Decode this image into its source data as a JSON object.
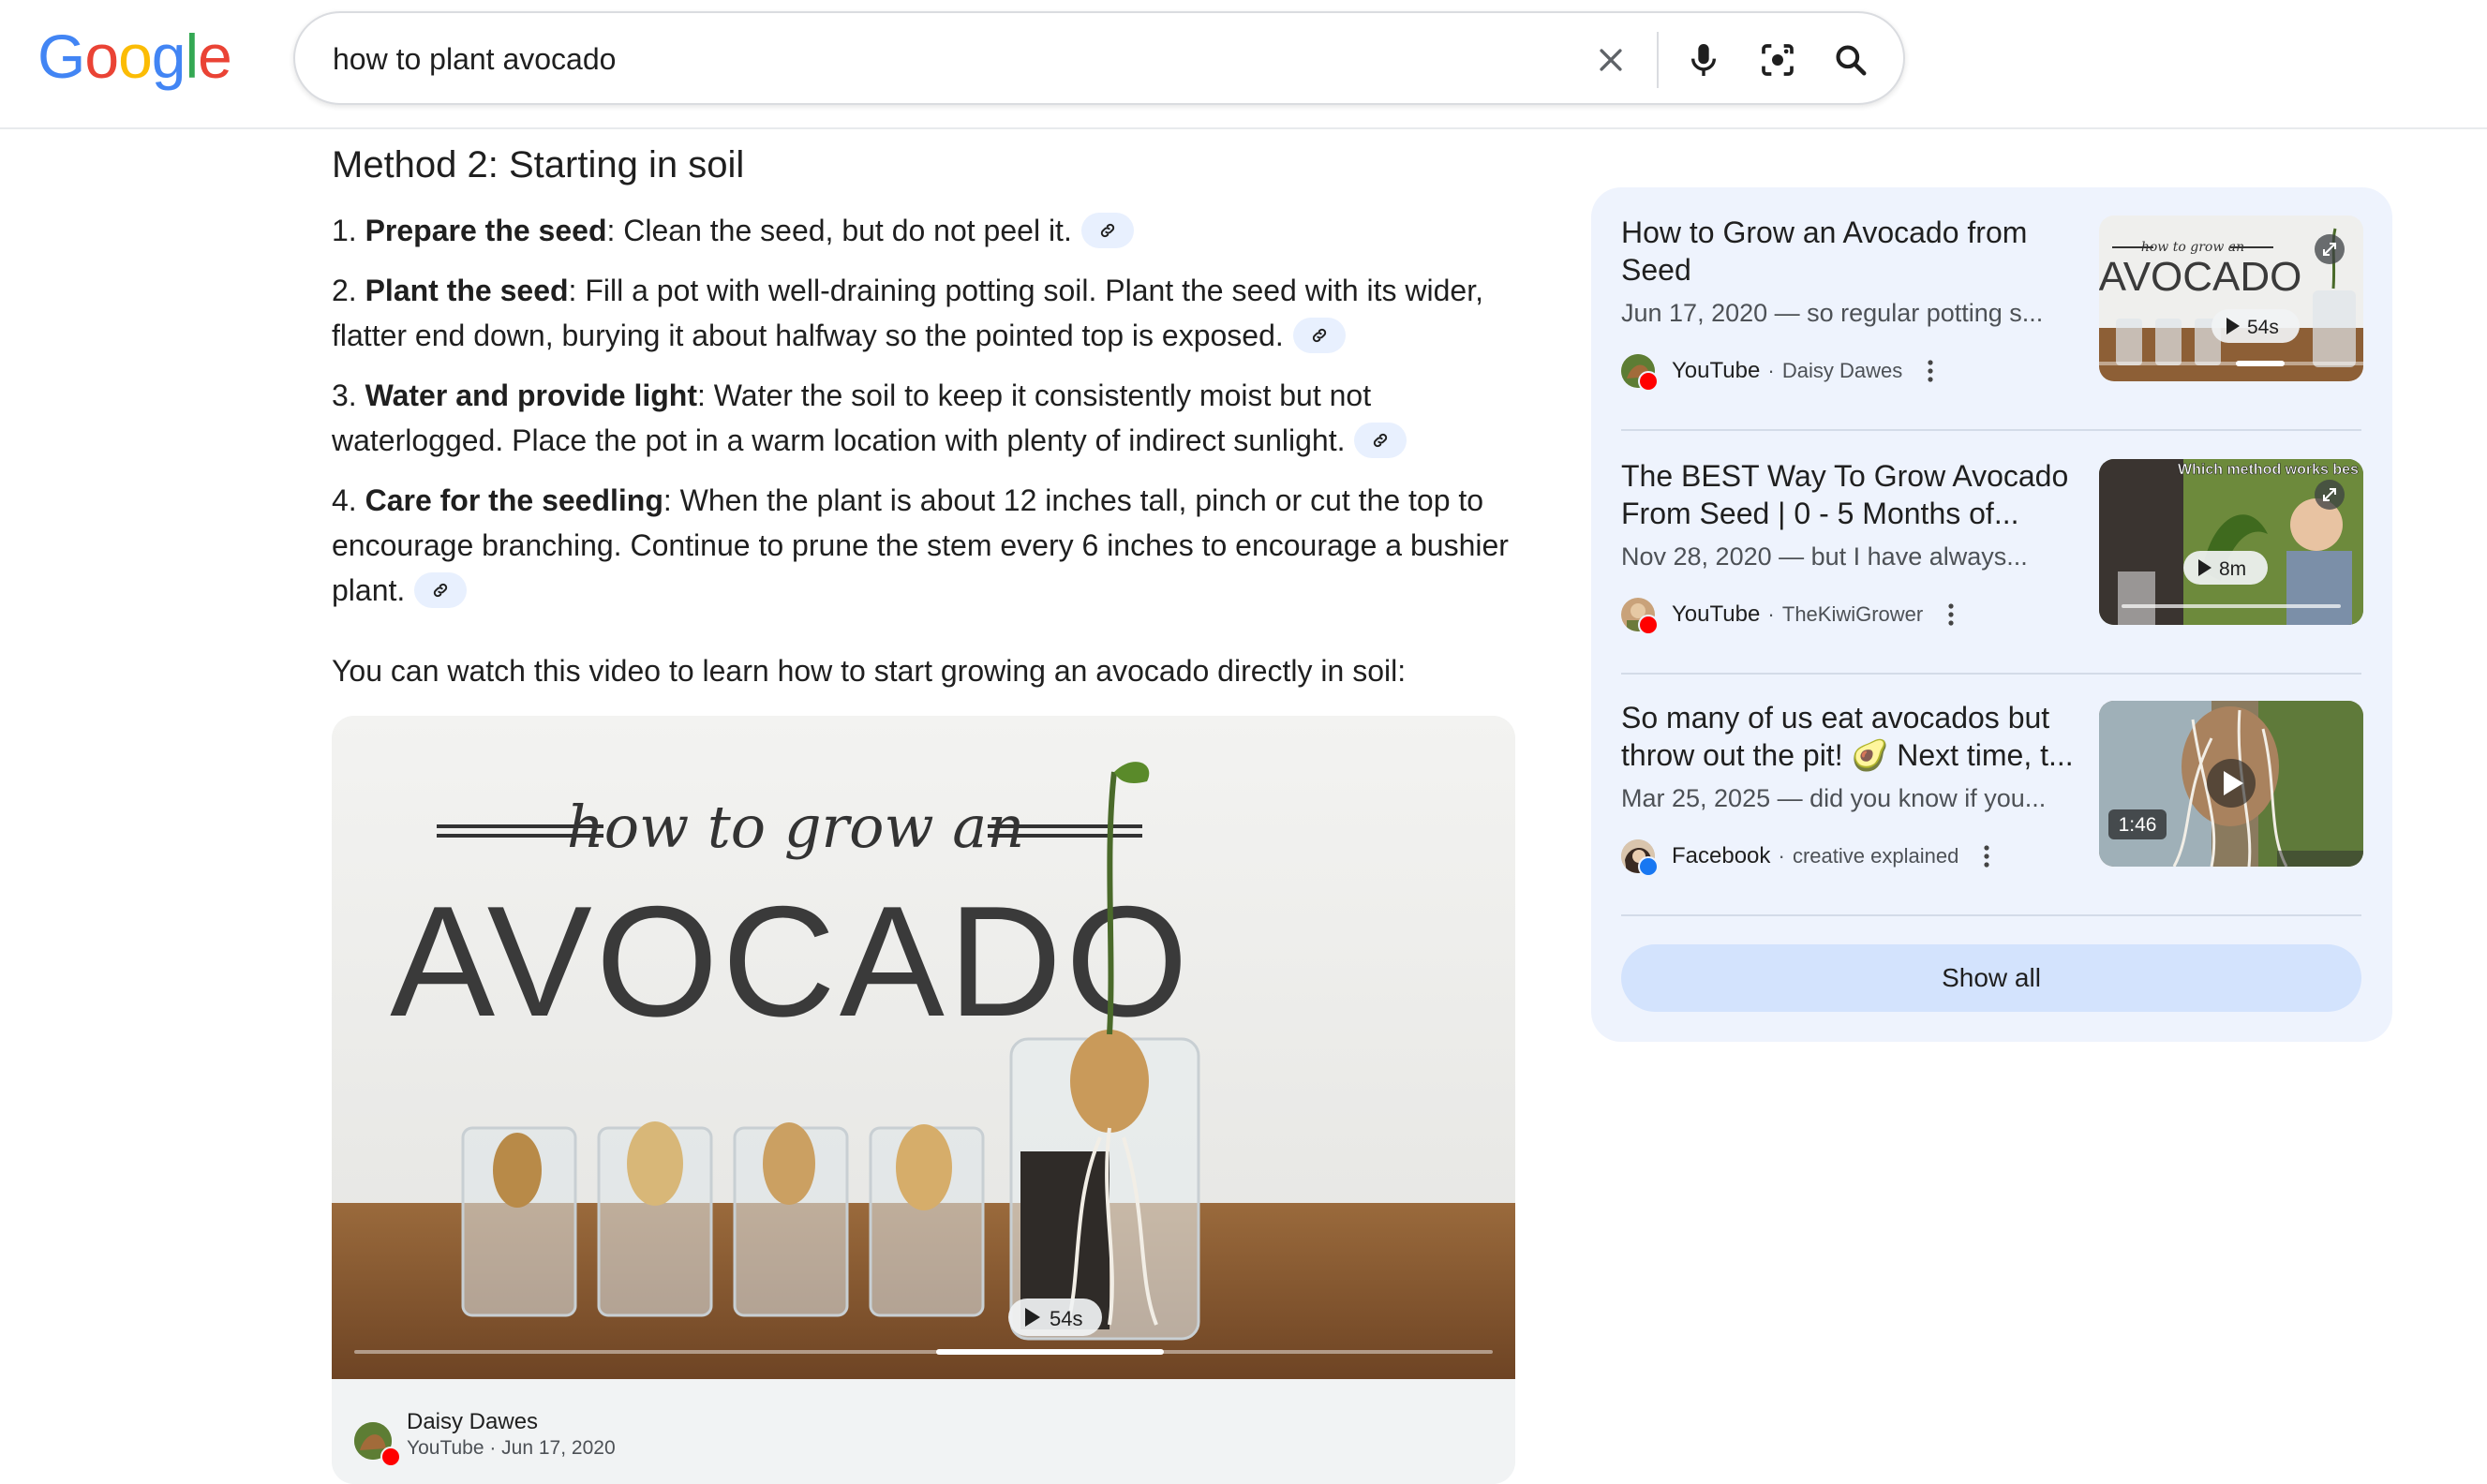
{
  "header": {
    "logo_letters": [
      "G",
      "o",
      "o",
      "g",
      "l",
      "e"
    ],
    "logo_colors": [
      "#4285F4",
      "#EA4335",
      "#FBBC05",
      "#4285F4",
      "#34A853",
      "#EA4335"
    ],
    "search_query": "how to plant avocado",
    "icons": [
      "clear-icon",
      "microphone-icon",
      "camera-lens-icon",
      "search-icon"
    ]
  },
  "main": {
    "heading": "Method 2: Starting in soil",
    "steps": [
      {
        "num": "1. ",
        "bold": "Prepare the seed",
        "text": ": Clean the seed, but do not peel it."
      },
      {
        "num": "2. ",
        "bold": "Plant the seed",
        "text": ": Fill a pot with well-draining potting soil. Plant the seed with its wider, flatter end down, burying it about halfway so the pointed top is exposed."
      },
      {
        "num": "3. ",
        "bold": "Water and provide light",
        "text": ": Water the soil to keep it consistently moist but not waterlogged. Place the pot in a warm location with plenty of indirect sunlight."
      },
      {
        "num": "4. ",
        "bold": "Care for the seedling",
        "text": ": When the plant is about 12 inches tall, pinch or cut the top to encourage branching. Continue to prune the stem every 6 inches to encourage a bushier plant."
      }
    ],
    "intro": "You can watch this video to learn how to start growing an avocado directly in soil:",
    "video": {
      "thumb_script_text": "how to grow an",
      "thumb_big_text": "AVOCADO",
      "duration": "54s",
      "progress": 0.2,
      "author": "Daisy Dawes",
      "meta": "YouTube · Jun 17, 2020"
    }
  },
  "side": {
    "results": [
      {
        "title": "How to Grow an Avocado from Seed",
        "snippet": "Jun 17, 2020 — so regular potting s...",
        "platform": "YouTube",
        "channel": "Daisy Dawes",
        "thumb_small_text": "how to grow an",
        "thumb_big_text": "AVOCADO",
        "duration": "54s"
      },
      {
        "title": "The BEST Way To Grow Avocado From Seed | 0 - 5 Months of...",
        "snippet": "Nov 28, 2020 — but I have always...",
        "platform": "YouTube",
        "channel": "TheKiwiGrower",
        "thumb_text": "Which method works bes",
        "duration": "8m"
      },
      {
        "title": "So many of us eat avocados but throw out the pit! 🥑 Next time, t...",
        "snippet": "Mar 25, 2025 — did you know if you...",
        "platform": "Facebook",
        "channel": "creative explained",
        "duration": "1:46"
      }
    ],
    "show_all": "Show all"
  }
}
